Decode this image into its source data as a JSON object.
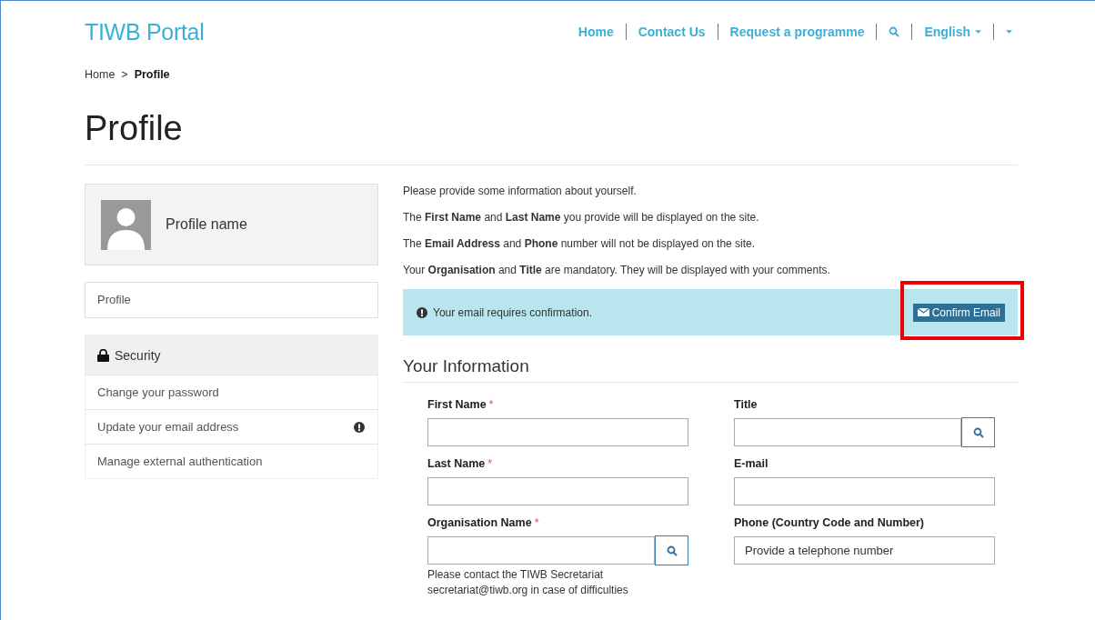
{
  "header": {
    "logo": "TIWB Portal",
    "nav": [
      {
        "kind": "link",
        "label": "Home"
      },
      {
        "kind": "link",
        "label": "Contact Us"
      },
      {
        "kind": "link",
        "label": "Request a programme"
      },
      {
        "kind": "search"
      },
      {
        "kind": "dropdown",
        "label": "English"
      },
      {
        "kind": "dropdown"
      }
    ]
  },
  "breadcrumb": {
    "items": [
      "Home",
      "Profile"
    ],
    "separator": ">"
  },
  "page_title": "Profile",
  "sidebar": {
    "profile_name": "Profile name",
    "profile_link": "Profile",
    "security": {
      "title": "Security",
      "items": [
        {
          "label": "Change your password",
          "warning": false
        },
        {
          "label": "Update your email address",
          "warning": true
        },
        {
          "label": "Manage external authentication",
          "warning": false
        }
      ]
    }
  },
  "intro": [
    "Please provide some information about yourself.",
    "The **First Name** and **Last Name** you provide will be displayed on the site.",
    "The **Email Address** and **Phone** number will not be displayed on the site.",
    "Your **Organisation** and **Title** are mandatory. They will be displayed with your comments."
  ],
  "alert": {
    "message": "Your email requires confirmation.",
    "button": {
      "label": "Confirm Email",
      "highlighted": true
    }
  },
  "section_title": "Your Information",
  "form": {
    "fields": [
      {
        "label": "First Name",
        "required": true,
        "lookup": false
      },
      {
        "label": "Title",
        "required": false,
        "lookup": true
      },
      {
        "label": "Last Name",
        "required": true,
        "lookup": false
      },
      {
        "label": "E-mail",
        "required": false,
        "lookup": false
      },
      {
        "label": "Organisation Name",
        "required": true,
        "lookup": true,
        "help": "Please contact the TIWB Secretariat secretariat@tiwb.org in case of difficulties"
      },
      {
        "label": "Phone (Country Code and Number)",
        "required": false,
        "lookup": false,
        "placeholder": "Provide a telephone number"
      }
    ],
    "required_mark": "*"
  }
}
